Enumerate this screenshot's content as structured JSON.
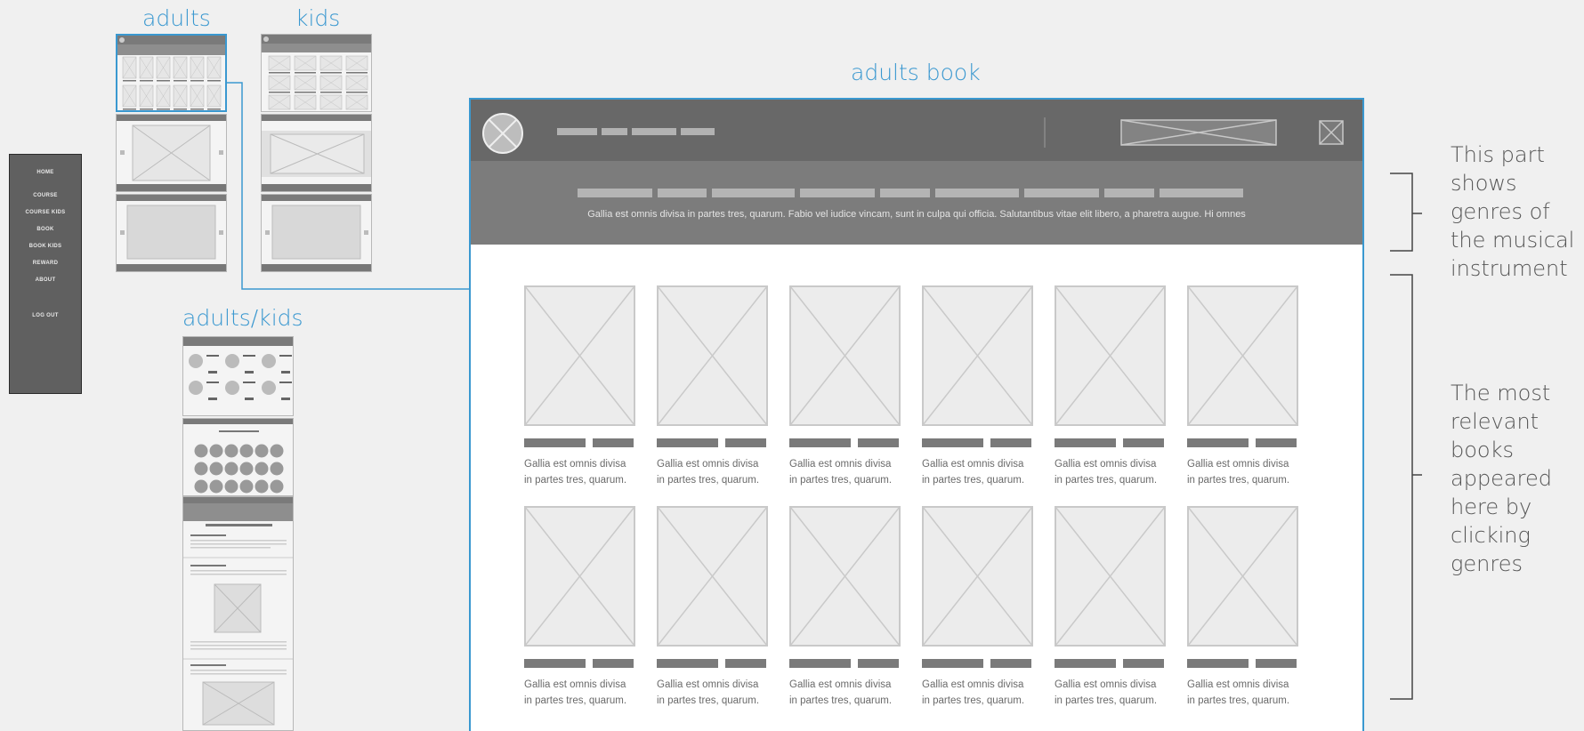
{
  "labels": {
    "adults": "adults",
    "kids": "kids",
    "adults_kids": "adults/kids",
    "adults_book": "adults book"
  },
  "side_menu": [
    "HOME",
    "COURSE",
    "COURSE KIDS",
    "BOOK",
    "BOOK KIDS",
    "REWARD",
    "ABOUT",
    "LOG OUT"
  ],
  "main": {
    "genre_description": "Gallia est omnis divisa in partes tres, quarum. Fabio vel iudice vincam, sunt in culpa qui officia. Salutantibus vitae elit libero, a pharetra augue. Hi omnes",
    "book_caption": "Gallia est omnis divisa in partes tres, quarum."
  },
  "annotations": {
    "genres": "This part shows genres of the musical instrument",
    "books": "The most relevant books appeared here by clicking genres"
  },
  "colors": {
    "accent": "#3a98d0",
    "nav_dark": "#686868",
    "genre_bar": "#7c7c7c",
    "placeholder": "#ececec"
  }
}
